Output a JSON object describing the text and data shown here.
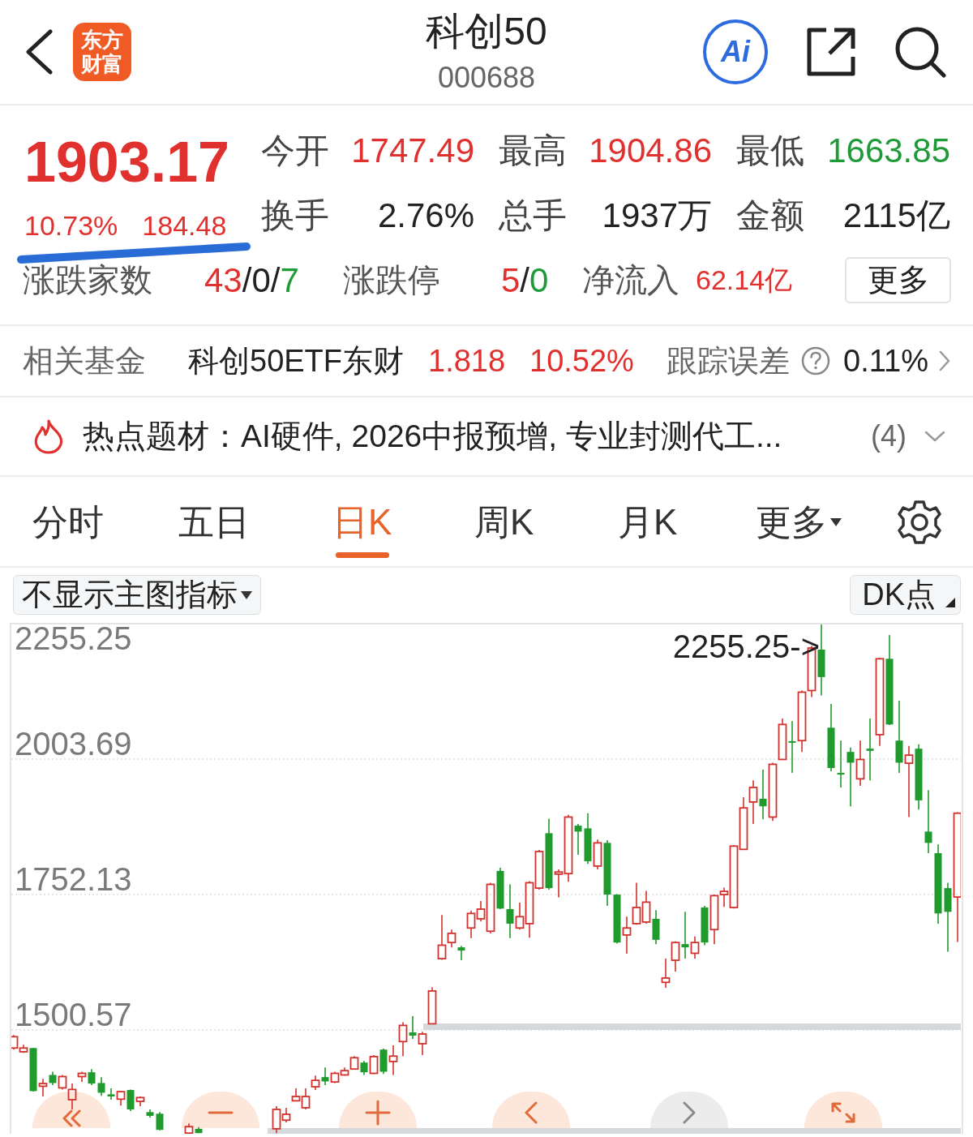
{
  "header": {
    "logo_text": "东方财富",
    "title": "科创50",
    "code": "000688",
    "ai_label": "Ai"
  },
  "quote": {
    "price": "1903.17",
    "change_pct": "10.73%",
    "change": "184.48",
    "color": "#e0312f"
  },
  "stats": [
    {
      "label": "今开",
      "value": "1747.49",
      "color": "#e0312f"
    },
    {
      "label": "最高",
      "value": "1904.86",
      "color": "#e0312f"
    },
    {
      "label": "最低",
      "value": "1663.85",
      "color": "#1f9a38"
    },
    {
      "label": "换手",
      "value": "2.76%",
      "color": "#222222"
    },
    {
      "label": "总手",
      "value": "1937万",
      "color": "#222222"
    },
    {
      "label": "金额",
      "value": "2115亿",
      "color": "#222222"
    }
  ],
  "breadth": [
    {
      "label": "涨跌家数",
      "kind": "ratio",
      "parts": [
        {
          "text": "43",
          "color": "#e0312f"
        },
        {
          "text": "/",
          "color": "#222222"
        },
        {
          "text": "0",
          "color": "#222222"
        },
        {
          "text": "/",
          "color": "#222222"
        },
        {
          "text": "7",
          "color": "#1f9a38"
        }
      ]
    },
    {
      "label": "涨跌停",
      "kind": "ratio",
      "parts": [
        {
          "text": "5",
          "color": "#e0312f"
        },
        {
          "text": "/",
          "color": "#222222"
        },
        {
          "text": "0",
          "color": "#1f9a38"
        }
      ]
    },
    {
      "label": "净流入",
      "kind": "amount",
      "parts": [
        {
          "text": "62.14亿",
          "color": "#e0312f"
        }
      ]
    }
  ],
  "more_button": "更多",
  "fund": {
    "label": "相关基金",
    "name": "科创50ETF东财",
    "price": "1.818",
    "change": "10.52%",
    "color": "#e0312f",
    "tracking_label": "跟踪误差",
    "tracking_value": "0.11%"
  },
  "hot_topics": {
    "text": "热点题材：AI硬件, 2026中报预增, 专业封测代工...",
    "count": "(4)"
  },
  "tabs": [
    {
      "label": "分时",
      "kind": "period",
      "selected": false
    },
    {
      "label": "五日",
      "kind": "period",
      "selected": false
    },
    {
      "label": "日K",
      "kind": "period",
      "selected": true
    },
    {
      "label": "周K",
      "kind": "period",
      "selected": false
    },
    {
      "label": "月K",
      "kind": "period",
      "selected": false
    },
    {
      "label": "更多",
      "kind": "menu",
      "selected": false
    }
  ],
  "chart": {
    "indicator_menu": "不显示主图指标",
    "dk_button": "DK点",
    "chart_data": {
      "type": "candlestick",
      "categories": [
        null,
        null,
        null,
        null,
        null,
        null,
        null,
        null,
        null,
        null,
        null,
        null,
        null,
        null,
        null,
        null,
        null,
        null,
        null,
        null,
        null,
        null,
        null,
        null,
        null,
        null,
        null,
        null,
        null,
        null,
        null,
        null,
        null,
        null,
        null,
        null,
        null,
        null,
        null,
        null,
        null,
        null,
        null,
        null,
        null,
        null,
        null,
        null,
        null,
        null,
        null,
        null,
        null,
        null,
        null,
        null,
        null,
        null,
        null,
        null,
        null,
        null,
        null,
        null,
        null,
        null,
        null,
        null,
        null,
        null,
        null,
        null,
        null,
        null,
        null,
        null,
        null,
        null,
        null,
        null,
        null,
        null,
        null,
        null,
        null,
        null,
        null,
        null,
        null,
        null,
        null,
        null,
        null,
        null,
        null,
        null,
        null,
        null
      ],
      "ohlc": [
        [
          1467,
          1491,
          1464,
          1488
        ],
        [
          1460,
          1473,
          1458,
          1467
        ],
        [
          1467,
          1467,
          1386,
          1387
        ],
        [
          1396,
          1410,
          1377,
          1401
        ],
        [
          1417,
          1423,
          1398,
          1402
        ],
        [
          1393,
          1417,
          1390,
          1414
        ],
        [
          1371,
          1401,
          1353,
          1390
        ],
        [
          1414,
          1423,
          1404,
          1420
        ],
        [
          1422,
          1428,
          1398,
          1401
        ],
        [
          1402,
          1413,
          1378,
          1384
        ],
        [
          1381,
          1392,
          1371,
          1377
        ],
        [
          1372,
          1387,
          1360,
          1386
        ],
        [
          1389,
          1390,
          1350,
          1353
        ],
        [
          1368,
          1377,
          1359,
          1375
        ],
        [
          1348,
          1353,
          1338,
          1341
        ],
        [
          1345,
          1348,
          1314,
          1315
        ],
        null,
        null,
        [
          1309,
          1327,
          1309,
          1321
        ],
        [
          1317,
          1320,
          1309,
          1309
        ],
        null,
        null,
        null,
        null,
        null,
        null,
        null,
        [
          1317,
          1359,
          1309,
          1353
        ],
        [
          1333,
          1356,
          1329,
          1344
        ],
        [
          1369,
          1392,
          1368,
          1377
        ],
        [
          1356,
          1392,
          1353,
          1377
        ],
        [
          1395,
          1416,
          1389,
          1407
        ],
        [
          1413,
          1431,
          1398,
          1405
        ],
        [
          1404,
          1423,
          1402,
          1420
        ],
        [
          1417,
          1431,
          1416,
          1425
        ],
        [
          1428,
          1452,
          1427,
          1449
        ],
        [
          1440,
          1443,
          1417,
          1422
        ],
        [
          1420,
          1454,
          1419,
          1451
        ],
        [
          1464,
          1466,
          1419,
          1423
        ],
        [
          1442,
          1472,
          1417,
          1452
        ],
        [
          1479,
          1515,
          1452,
          1509
        ],
        [
          1496,
          1526,
          1484,
          1490
        ],
        [
          1475,
          1497,
          1454,
          1493
        ],
        [
          1512,
          1580,
          1511,
          1573
        ],
        [
          1633,
          1714,
          1631,
          1658
        ],
        [
          1663,
          1687,
          1654,
          1680
        ],
        [
          1654,
          1657,
          1630,
          1648
        ],
        [
          1690,
          1722,
          1671,
          1717
        ],
        [
          1707,
          1740,
          1702,
          1725
        ],
        [
          1684,
          1774,
          1680,
          1771
        ],
        [
          1796,
          1802,
          1725,
          1726
        ],
        [
          1725,
          1771,
          1671,
          1698
        ],
        [
          1690,
          1737,
          1687,
          1711
        ],
        [
          1698,
          1777,
          1672,
          1774
        ],
        [
          1764,
          1835,
          1761,
          1832
        ],
        [
          1866,
          1893,
          1761,
          1764
        ],
        [
          1790,
          1799,
          1747,
          1794
        ],
        [
          1791,
          1900,
          1776,
          1896
        ],
        [
          1880,
          1883,
          1826,
          1869
        ],
        [
          1875,
          1903,
          1809,
          1814
        ],
        [
          1805,
          1854,
          1799,
          1848
        ],
        [
          1848,
          1853,
          1731,
          1752
        ],
        [
          1752,
          1753,
          1661,
          1663
        ],
        [
          1677,
          1711,
          1642,
          1690
        ],
        [
          1698,
          1774,
          1696,
          1728
        ],
        [
          1701,
          1759,
          1698,
          1738
        ],
        [
          1707,
          1723,
          1660,
          1668
        ],
        [
          1589,
          1633,
          1579,
          1597
        ],
        [
          1630,
          1665,
          1609,
          1663
        ],
        [
          1660,
          1720,
          1633,
          1654
        ],
        [
          1643,
          1674,
          1633,
          1663
        ],
        [
          1728,
          1731,
          1658,
          1663
        ],
        [
          1687,
          1752,
          1660,
          1750
        ],
        [
          1752,
          1765,
          1729,
          1758
        ],
        [
          1728,
          1844,
          1726,
          1842
        ],
        [
          1836,
          1933,
          1835,
          1913
        ],
        [
          1924,
          1964,
          1883,
          1951
        ],
        [
          1930,
          1984,
          1892,
          1916
        ],
        [
          1896,
          1997,
          1889,
          1994
        ],
        [
          2003,
          2079,
          2002,
          2068
        ],
        [
          2037,
          2074,
          1978,
          2034
        ],
        [
          2038,
          2131,
          2017,
          2128
        ],
        [
          2131,
          2214,
          2119,
          2210
        ],
        [
          2207,
          2255.25,
          2122,
          2156
        ],
        [
          2062,
          2106,
          1981,
          1987
        ],
        [
          1978,
          2038,
          1951,
          1975
        ],
        [
          2017,
          2025,
          1916,
          1997
        ],
        [
          1967,
          2038,
          1954,
          2003
        ],
        [
          2023,
          2079,
          1964,
          2019
        ],
        [
          2049,
          2192,
          2028,
          2190
        ],
        [
          2190,
          2234,
          2067,
          2068
        ],
        [
          2038,
          2112,
          1978,
          1997
        ],
        [
          1996,
          2028,
          1896,
          2011
        ],
        [
          2023,
          2031,
          1910,
          1927
        ],
        [
          1869,
          1946,
          1829,
          1848
        ],
        [
          1829,
          1845,
          1698,
          1717
        ],
        [
          1764,
          1774,
          1646,
          1720
        ],
        [
          1747.49,
          1904.86,
          1663.85,
          1903.17
        ]
      ],
      "ylim": [
        1307.76,
        2255.25
      ],
      "yticks": [
        {
          "value": 2255.25,
          "label": "2255.25"
        },
        {
          "value": 2003.69,
          "label": "2003.69"
        },
        {
          "value": 1752.13,
          "label": "1752.13"
        },
        {
          "value": 1500.57,
          "label": "1500.57"
        }
      ],
      "grid": true,
      "annotations": [
        {
          "text": "2255.25->"
        }
      ]
    }
  },
  "chart_controls": [
    {
      "kind": "rewind",
      "disabled": false
    },
    {
      "kind": "zoom-out",
      "disabled": false
    },
    {
      "kind": "zoom-in",
      "disabled": false
    },
    {
      "kind": "prev",
      "disabled": false
    },
    {
      "kind": "next",
      "disabled": true
    },
    {
      "kind": "fullscreen",
      "disabled": false
    }
  ]
}
